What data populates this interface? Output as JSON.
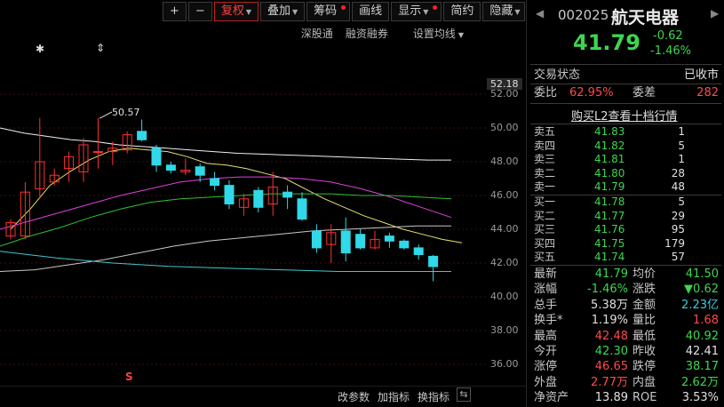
{
  "toolbar": {
    "plus": "+",
    "minus": "−",
    "fuquan": "复权",
    "diejia": "叠加",
    "chouma": "筹码",
    "huaxian": "画线",
    "xianshi": "显示",
    "jianyue": "简约",
    "yincang": "隐藏",
    "fullscreen": "⛶"
  },
  "sub_links": {
    "shenlutong": "深股通",
    "rongzi": "融资融券",
    "junxian": "设置均线"
  },
  "chart_marks": {
    "high_label": "50.57",
    "asterisk": "✱",
    "arrow": "⇕",
    "s_mark": "S"
  },
  "y_axis": {
    "current": "52.18",
    "ticks": [
      "52.00",
      "50.00",
      "48.00",
      "46.00",
      "44.00",
      "42.00",
      "40.00",
      "38.00",
      "36.00"
    ]
  },
  "bottom_bar": {
    "gaicanshu": "改参数",
    "jiazhibiao": "加指标",
    "huanzhibiao": "换指标",
    "icon": "⇆"
  },
  "chart_data": {
    "type": "candlestick",
    "ylim": [
      34.5,
      54.5
    ],
    "candles": [
      {
        "o": 43.6,
        "c": 44.4,
        "h": 44.6,
        "l": 43.4
      },
      {
        "o": 43.6,
        "c": 46.2,
        "h": 46.8,
        "l": 43.4
      },
      {
        "o": 46.4,
        "c": 48.0,
        "h": 50.6,
        "l": 45.8
      },
      {
        "o": 46.8,
        "c": 47.2,
        "h": 47.6,
        "l": 46.6
      },
      {
        "o": 47.6,
        "c": 48.3,
        "h": 48.6,
        "l": 46.8
      },
      {
        "o": 47.4,
        "c": 49.0,
        "h": 49.4,
        "l": 46.8
      },
      {
        "o": 48.6,
        "c": 48.6,
        "h": 50.6,
        "l": 47.6
      },
      {
        "o": 48.6,
        "c": 48.8,
        "h": 49.2,
        "l": 47.8
      },
      {
        "o": 48.7,
        "c": 49.6,
        "h": 49.8,
        "l": 48.5
      },
      {
        "o": 49.8,
        "c": 49.3,
        "h": 50.5,
        "l": 49.2
      },
      {
        "o": 48.8,
        "c": 47.8,
        "h": 49.0,
        "l": 47.4
      },
      {
        "o": 47.8,
        "c": 47.5,
        "h": 48.0,
        "l": 47.3
      },
      {
        "o": 47.4,
        "c": 47.5,
        "h": 48.2,
        "l": 47.2
      },
      {
        "o": 47.7,
        "c": 47.2,
        "h": 47.9,
        "l": 46.8
      },
      {
        "o": 47.0,
        "c": 46.6,
        "h": 47.4,
        "l": 46.3
      },
      {
        "o": 46.6,
        "c": 45.5,
        "h": 46.9,
        "l": 45.2
      },
      {
        "o": 45.3,
        "c": 45.8,
        "h": 46.1,
        "l": 44.8
      },
      {
        "o": 46.3,
        "c": 45.3,
        "h": 46.5,
        "l": 45.0
      },
      {
        "o": 45.5,
        "c": 46.5,
        "h": 47.4,
        "l": 44.8
      },
      {
        "o": 46.2,
        "c": 45.9,
        "h": 46.6,
        "l": 45.2
      },
      {
        "o": 45.8,
        "c": 44.6,
        "h": 46.2,
        "l": 44.5
      },
      {
        "o": 43.9,
        "c": 42.9,
        "h": 44.3,
        "l": 42.6
      },
      {
        "o": 43.1,
        "c": 43.8,
        "h": 44.3,
        "l": 42.0
      },
      {
        "o": 43.9,
        "c": 42.6,
        "h": 44.7,
        "l": 42.1
      },
      {
        "o": 43.7,
        "c": 42.9,
        "h": 44.0,
        "l": 42.8
      },
      {
        "o": 42.9,
        "c": 43.4,
        "h": 43.9,
        "l": 42.8
      },
      {
        "o": 43.6,
        "c": 43.3,
        "h": 43.8,
        "l": 42.9
      },
      {
        "o": 43.3,
        "c": 42.9,
        "h": 43.4,
        "l": 42.8
      },
      {
        "o": 42.9,
        "c": 42.5,
        "h": 43.1,
        "l": 42.2
      },
      {
        "o": 42.4,
        "c": 41.79,
        "h": 42.48,
        "l": 40.92
      }
    ],
    "ma_lines": [
      {
        "name": "ma5",
        "color": "#f0f0f0",
        "values": [
          50.0,
          49.7,
          49.5,
          49.3,
          49.2,
          49.0,
          48.9,
          48.8,
          48.7,
          48.6,
          48.5,
          48.45,
          48.4,
          48.35,
          48.3,
          48.25,
          48.2,
          48.15,
          48.1,
          48.1
        ]
      },
      {
        "name": "ma10",
        "color": "#e8e070",
        "values": [
          44.0,
          45.2,
          46.6,
          47.4,
          48.1,
          48.6,
          48.8,
          48.7,
          48.6,
          48.3,
          47.9,
          47.8,
          47.6,
          47.3,
          47.0,
          46.4,
          45.8,
          45.3,
          44.8,
          44.4,
          44.0,
          43.7,
          43.4,
          43.2
        ]
      },
      {
        "name": "ma20",
        "color": "#e040e0",
        "values": [
          44.0,
          44.5,
          45.0,
          45.5,
          46.0,
          46.4,
          46.8,
          47.0,
          47.1,
          47.1,
          47.0,
          46.8,
          46.4,
          45.9,
          45.3,
          44.7
        ]
      },
      {
        "name": "ma30",
        "color": "#30c030",
        "values": [
          43.0,
          43.6,
          44.1,
          44.7,
          45.2,
          45.6,
          45.8,
          45.9,
          46.0,
          46.1,
          46.1,
          46.1,
          46.0,
          46.0,
          45.9,
          45.8
        ]
      },
      {
        "name": "ma60",
        "color": "#c8c8c8",
        "values": [
          41.5,
          41.6,
          41.9,
          42.2,
          42.6,
          43.0,
          43.3,
          43.5,
          43.7,
          43.9,
          44.0,
          44.1,
          44.2,
          44.2
        ]
      },
      {
        "name": "ma120",
        "color": "#40c8d0",
        "values": [
          42.7,
          42.3,
          42.0,
          41.8,
          41.7,
          41.6,
          41.5,
          41.5,
          41.5
        ]
      }
    ]
  },
  "panel": {
    "code": "002025",
    "name": "航天电器",
    "price": "41.79",
    "change": "-0.62",
    "change_pct": "-1.46%",
    "trade_status_label": "交易状态",
    "trade_status": "已收市",
    "weibi_label": "委比",
    "weibi": "62.95%",
    "weicha_label": "委差",
    "weicha": "282",
    "l2_link": "购买L2查看十档行情",
    "asks": [
      {
        "label": "卖五",
        "price": "41.83",
        "vol": "1"
      },
      {
        "label": "卖四",
        "price": "41.82",
        "vol": "5"
      },
      {
        "label": "卖三",
        "price": "41.81",
        "vol": "1"
      },
      {
        "label": "卖二",
        "price": "41.80",
        "vol": "28"
      },
      {
        "label": "卖一",
        "price": "41.79",
        "vol": "48"
      }
    ],
    "bids": [
      {
        "label": "买一",
        "price": "41.78",
        "vol": "5"
      },
      {
        "label": "买二",
        "price": "41.77",
        "vol": "29"
      },
      {
        "label": "买三",
        "price": "41.76",
        "vol": "95"
      },
      {
        "label": "买四",
        "price": "41.75",
        "vol": "179"
      },
      {
        "label": "买五",
        "price": "41.74",
        "vol": "57"
      }
    ],
    "stats": [
      {
        "l1": "最新",
        "v1": "41.79",
        "c1": "g",
        "l2": "均价",
        "v2": "41.50",
        "c2": "g"
      },
      {
        "l1": "涨幅",
        "v1": "-1.46%",
        "c1": "g",
        "l2": "涨跌",
        "v2": "▼0.62",
        "c2": "g"
      },
      {
        "l1": "总手",
        "v1": "5.38万",
        "c1": "w",
        "l2": "金额",
        "v2": "2.23亿",
        "c2": "c"
      },
      {
        "l1": "换手*",
        "v1": "1.19%",
        "c1": "w",
        "l2": "量比",
        "v2": "1.68",
        "c2": "r"
      },
      {
        "l1": "最高",
        "v1": "42.48",
        "c1": "r",
        "l2": "最低",
        "v2": "40.92",
        "c2": "g"
      },
      {
        "l1": "今开",
        "v1": "42.30",
        "c1": "g",
        "l2": "昨收",
        "v2": "42.41",
        "c2": "w"
      },
      {
        "l1": "涨停",
        "v1": "46.65",
        "c1": "r",
        "l2": "跌停",
        "v2": "38.17",
        "c2": "g"
      },
      {
        "l1": "外盘",
        "v1": "2.77万",
        "c1": "r",
        "l2": "内盘",
        "v2": "2.62万",
        "c2": "g"
      },
      {
        "l1": "净资产",
        "v1": "13.89",
        "c1": "w",
        "l2": "ROE",
        "v2": "3.53%",
        "c2": "w"
      }
    ]
  },
  "colors": {
    "up": "#ff3030",
    "down": "#30d8e8",
    "green": "#3dd64f",
    "red": "#ff4a4a"
  }
}
